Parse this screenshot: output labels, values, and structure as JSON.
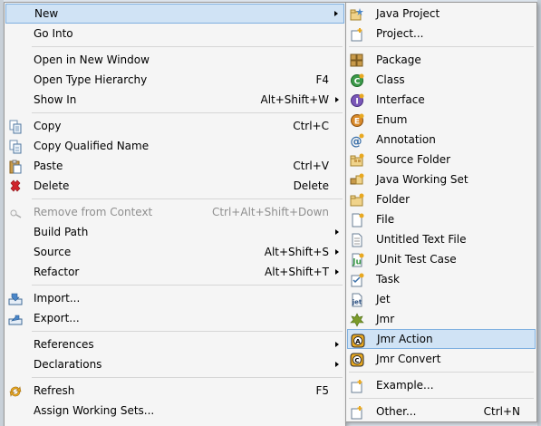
{
  "main_menu": {
    "new": "New",
    "go_into": "Go Into",
    "open_new_window": "Open in New Window",
    "open_type_hierarchy": "Open Type Hierarchy",
    "open_type_hierarchy_sc": "F4",
    "show_in": "Show In",
    "show_in_sc": "Alt+Shift+W",
    "copy": "Copy",
    "copy_sc": "Ctrl+C",
    "copy_qualified": "Copy Qualified Name",
    "paste": "Paste",
    "paste_sc": "Ctrl+V",
    "delete": "Delete",
    "delete_sc": "Delete",
    "remove_context": "Remove from Context",
    "remove_context_sc": "Ctrl+Alt+Shift+Down",
    "build_path": "Build Path",
    "source": "Source",
    "source_sc": "Alt+Shift+S",
    "refactor": "Refactor",
    "refactor_sc": "Alt+Shift+T",
    "import": "Import...",
    "export": "Export...",
    "references": "References",
    "declarations": "Declarations",
    "refresh": "Refresh",
    "refresh_sc": "F5",
    "assign_working_sets": "Assign Working Sets..."
  },
  "sub_menu": {
    "java_project": "Java Project",
    "project": "Project...",
    "package": "Package",
    "class": "Class",
    "interface": "Interface",
    "enum": "Enum",
    "annotation": "Annotation",
    "source_folder": "Source Folder",
    "java_working_set": "Java Working Set",
    "folder": "Folder",
    "file": "File",
    "untitled_text_file": "Untitled Text File",
    "junit_test_case": "JUnit Test Case",
    "task": "Task",
    "jet": "Jet",
    "jmr": "Jmr",
    "jmr_action": "Jmr Action",
    "jmr_convert": "Jmr Convert",
    "example": "Example...",
    "other": "Other...",
    "other_sc": "Ctrl+N"
  },
  "colors": {
    "highlight": "#d0e3f5",
    "highlight_border": "#7fb0e0",
    "disabled": "#8f8f8f",
    "delete_icon": "#d0242b"
  }
}
